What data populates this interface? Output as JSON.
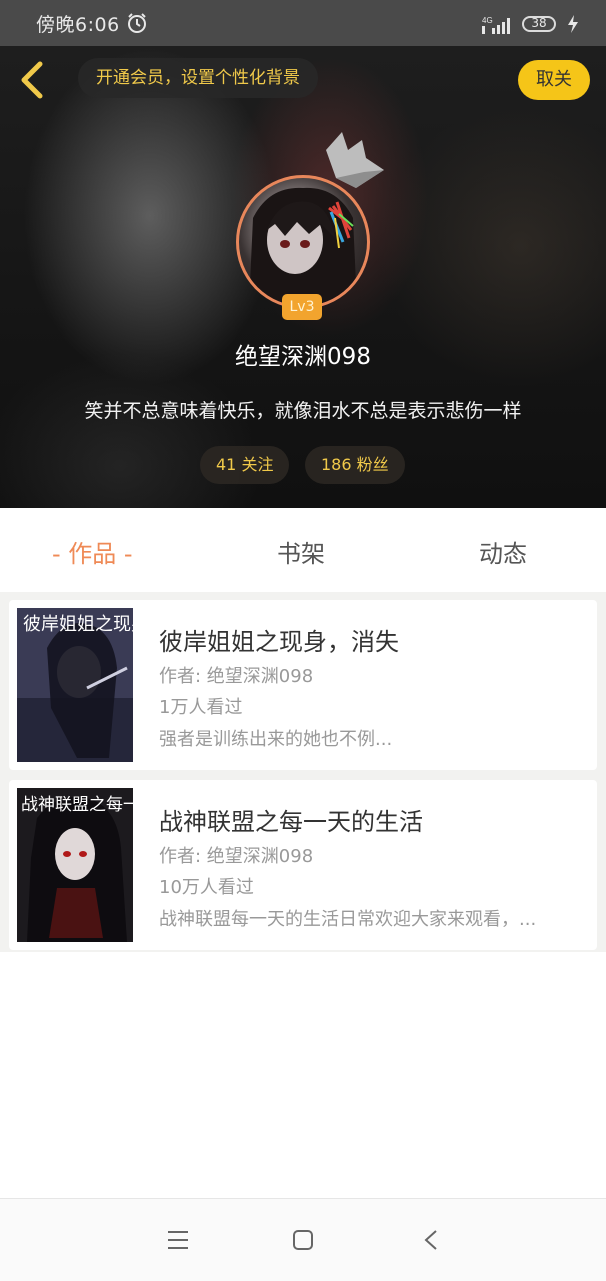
{
  "status_bar": {
    "time": "傍晚6:06",
    "network": "4G",
    "battery": "38"
  },
  "header": {
    "vip_banner": "开通会员，设置个性化背景",
    "unfollow_label": "取关",
    "level": "Lv3",
    "username": "绝望深渊098",
    "bio": "笑并不总意味着快乐，就像泪水不总是表示悲伤一样",
    "following": "41 关注",
    "followers": "186 粉丝"
  },
  "tabs": [
    {
      "label": "- 作品 -",
      "active": true
    },
    {
      "label": "书架",
      "active": false
    },
    {
      "label": "动态",
      "active": false
    }
  ],
  "books": [
    {
      "title": "彼岸姐姐之现身，消失",
      "author": "作者: 绝望深渊098",
      "views": "1万人看过",
      "description": "强者是训练出来的她也不例...",
      "cover_text": "彼岸姐姐之现身"
    },
    {
      "title": "战神联盟之每一天的生活",
      "author": "作者: 绝望深渊098",
      "views": "10万人看过",
      "description": "战神联盟每一天的生活日常欢迎大家来观看，...",
      "cover_text": "战神联盟之每一天的生活"
    }
  ],
  "icons": {
    "back": "back-icon",
    "alarm": "alarm-icon",
    "crown": "crown-icon",
    "nav_menu": "menu-icon",
    "nav_home": "home-icon",
    "nav_back": "nav-back-icon"
  },
  "colors": {
    "accent_orange": "#ef8a56",
    "gold": "#f0c94a",
    "unfollow_yellow": "#f5c518"
  }
}
